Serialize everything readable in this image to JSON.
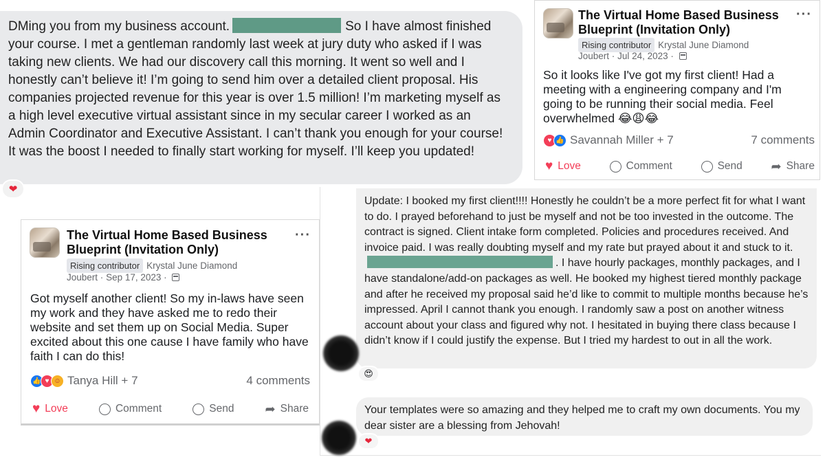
{
  "dm": {
    "text_before": "DMing you from my business account.",
    "text_after": "So I have almost finished your course. I met a gentleman randomly last week at jury duty who asked if I was taking new clients. We had our discovery call this morning. It went so well and I honestly can’t believe it! I’m going to send him over a detailed client proposal. His companies projected revenue for this year is over 1.5 million! I’m marketing myself as a high level executive virtual assistant since in my secular career I worked as an Admin Coordinator and Executive Assistant. I can’t thank you enough for your course! It was the boost I needed to finally start working for myself. I’ll keep you updated!",
    "reaction": "❤"
  },
  "post1": {
    "group": "The Virtual Home Based Business Blueprint (Invitation Only)",
    "badge": "Rising contributor",
    "author": "Krystal June Diamond",
    "author_line2": "Joubert",
    "date": "Jul 24, 2023",
    "sep": "·",
    "menu": "···",
    "text": "So it looks like I've got my first client! Had a meeting with a engineering company and I'm going to be running their social media. Feel overwhelmed",
    "emojis": "😂😩😂",
    "reactors": "Savannah Miller + 7",
    "comments": "7 comments",
    "actions": {
      "love": "Love",
      "comment": "Comment",
      "send": "Send",
      "share": "Share"
    }
  },
  "post2": {
    "group": "The Virtual Home Based Business Blueprint (Invitation Only)",
    "badge": "Rising contributor",
    "author": "Krystal June Diamond",
    "author_line2": "Joubert",
    "date": "Sep 17, 2023",
    "sep": "·",
    "menu": "···",
    "text": "Got myself another client! So my in-laws have seen my work and they have asked me to redo their website and set them up on Social Media. Super excited about this one cause I have family who have faith I can do this!",
    "reactors": "Tanya Hill + 7",
    "comments": "4 comments",
    "actions": {
      "love": "Love",
      "comment": "Comment",
      "send": "Send",
      "share": "Share"
    }
  },
  "comment1": {
    "text_before": "Update: I booked my first client!!!! Honestly he couldn’t be a more perfect fit for what I want to do. I prayed beforehand to just be myself and not be too invested in the outcome. The contract is signed. Client intake form completed. Policies and procedures received. And invoice paid. I was really doubting myself and my rate but prayed about it and stuck to it.",
    "text_after": ". I have hourly packages, monthly packages, and I have standalone/add-on packages as well. He booked my highest tiered monthly package and after he received my proposal said he’d like to commit to multiple months because he’s impressed. April I cannot thank you enough. I randomly saw a post on another witness account about your class and figured why not. I hesitated in buying there class because I didn’t know if I could justify the expense. But I tried my hardest to out in all the work.",
    "reaction": "😍"
  },
  "comment2": {
    "text": "Your templates were so amazing and they helped me to craft my own documents. You my dear sister are a blessing from Jehovah!",
    "reaction": "❤"
  }
}
